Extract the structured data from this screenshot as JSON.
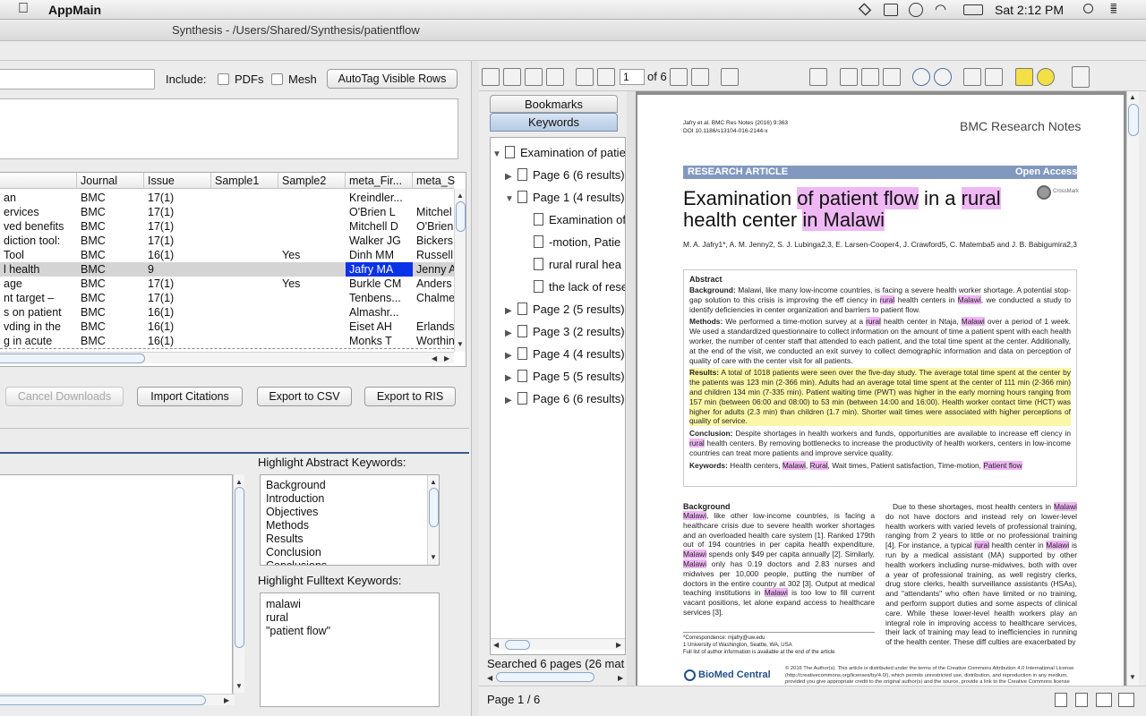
{
  "menubar": {
    "app_name": "AppMain",
    "clock": "Sat 2:12 PM"
  },
  "window": {
    "title": "Synthesis - /Users/Shared/Synthesis/patientflow"
  },
  "left_toolbar": {
    "include_label": "Include:",
    "pdfs_label": "PDFs",
    "mesh_label": "Mesh",
    "autotag_label": "AutoTag Visible Rows"
  },
  "table": {
    "headers": [
      "Journal",
      "Issue",
      "Sample1",
      "Sample2",
      "meta_Fir...",
      "meta_S"
    ],
    "rows": [
      [
        "an",
        "BMC",
        "17(1)",
        "",
        "",
        "Kreindler...",
        ""
      ],
      [
        "ervices",
        "BMC",
        "17(1)",
        "",
        "",
        "O'Brien L",
        "Mitchel"
      ],
      [
        "ved benefits",
        "BMC",
        "17(1)",
        "",
        "",
        "Mitchell D",
        "O'Brien"
      ],
      [
        "diction tool:",
        "BMC",
        "17(1)",
        "",
        "",
        "Walker JG",
        "Bickers"
      ],
      [
        "Tool",
        "BMC",
        "16(1)",
        "",
        "Yes",
        "Dinh MM",
        "Russell"
      ],
      [
        "l health",
        "BMC",
        "9",
        "",
        "",
        "Jafry MA",
        "Jenny A"
      ],
      [
        "age",
        "BMC",
        "17(1)",
        "",
        "Yes",
        "Burkle CM",
        "Anders"
      ],
      [
        "nt target –",
        "BMC",
        "17(1)",
        "",
        "",
        "Tenbens...",
        "Chalme"
      ],
      [
        "s on patient",
        "BMC",
        "16(1)",
        "",
        "",
        "Almashr...",
        ""
      ],
      [
        "vding in the",
        "BMC",
        "16(1)",
        "",
        "",
        "Eiset AH",
        "Erlands"
      ],
      [
        "g in acute",
        "BMC",
        "16(1)",
        "",
        "",
        "Monks T",
        "Worthin"
      ]
    ]
  },
  "actions": {
    "cancel": "Cancel Downloads",
    "import": "Import Citations",
    "export_csv": "Export to CSV",
    "export_ris": "Export to RIS"
  },
  "abstract_keywords": {
    "label": "Highlight Abstract Keywords:",
    "items": [
      "Background",
      "Introduction",
      "Objectives",
      "Methods",
      "Results",
      "Conclusion",
      "Conclusions"
    ]
  },
  "fulltext_keywords": {
    "label": "Highlight Fulltext Keywords:",
    "items": [
      "malawi",
      "rural",
      "\"patient flow\""
    ]
  },
  "pdf_toolbar": {
    "page_input": "1",
    "of_pages": "of 6"
  },
  "side_tabs": {
    "bookmarks": "Bookmarks",
    "keywords": "Keywords"
  },
  "tree": {
    "root": "Examination of patie",
    "nodes": [
      {
        "label": "Page 6 (6 results)",
        "level": 1,
        "expanded": false
      },
      {
        "label": "Page 1 (4 results)",
        "level": 1,
        "expanded": true
      },
      {
        "label": "Examination of",
        "level": 2
      },
      {
        "label": "-motion, Patie",
        "level": 2
      },
      {
        "label": "rural rural hea",
        "level": 2
      },
      {
        "label": "the lack of rese",
        "level": 2
      },
      {
        "label": "Page 2 (5 results)",
        "level": 1,
        "expanded": false
      },
      {
        "label": "Page 3 (2 results)",
        "level": 1,
        "expanded": false
      },
      {
        "label": "Page 4 (4 results)",
        "level": 1,
        "expanded": false
      },
      {
        "label": "Page 5 (5 results)",
        "level": 1,
        "expanded": false
      },
      {
        "label": "Page 6 (6 results)",
        "level": 1,
        "expanded": false
      }
    ],
    "status": "Searched 6 pages (26 mat"
  },
  "status_bar": {
    "page": "Page 1 / 6"
  },
  "pdf": {
    "cite": "Jafry et al. BMC Res Notes (2016) 9:363",
    "doi": "DOI 10.1186/s13104-016-2144-x",
    "journal": "BMC Research Notes",
    "type": "RESEARCH ARTICLE",
    "open_access": "Open Access",
    "title_a": "Examination ",
    "title_b": "of patient flow",
    " title_c": "",
    "title_c2": " in a ",
    "title_d": "rural",
    "title_e": "health center ",
    "title_f": "in Malawi",
    "authors": "M. A. Jafry1*, A. M. Jenny2, S. J. Lubinga2,3, E. Larsen-Cooper4, J. Crawford5, C. Matemba5 and J. B. Babigumira2,3",
    "abstract_h": "Abstract",
    "bg_label": "Background:",
    "bg_text1": "Malawi, like many low-income countries, is facing a severe health worker shortage. A potential stop-gap solution to this crisis is improving the eff ciency in ",
    "bg_rural": "rural",
    "bg_text2": " health centers in ",
    "bg_malawi": "Malawi",
    "bg_text3": ", we conducted a study to identify deficiencies in center organization and barriers to patient flow.",
    "m_label": "Methods:",
    "m_text1": "We performed a time-motion survey at a ",
    "m_rural": "rural",
    "m_text2": " health center in Ntaja, ",
    "m_malawi": "Malawi",
    "m_text3": " over a period of 1 week. We used a standardized questionnaire to collect information on the amount of time a patient spent with each health worker, the number of center staff that attended to each patient, and the total time spent at the center. Additionally, at the end of the visit, we conducted an exit survey to collect demographic information and data on perception of quality of care with the center visit for all patients.",
    "r_label": "Results:",
    "r_text": "A total of 1018 patients were seen over the five-day study. The average total time spent at the center by the patients was 123 min (2-366 min). Adults had an average total time spent at the center of 111 min (2-366 min) and children 134 min (7-335 min). Patient waiting time (PWT) was higher in the early morning hours ranging from 157 min (between 06:00 and 08:00) to 53 min (between 14:00 and 16:00). Health worker contact time (HCT) was higher for adults (2.3 min) than children (1.7 min). Shorter wait times were associated with higher perceptions of quality of service.",
    "c_label": "Conclusion:",
    "c_text1": "Despite shortages in health workers and funds, opportunities are available to increase eff ciency in ",
    "c_rural": "rural",
    "c_text2": " health centers. By removing bottlenecks to increase the productivity of health workers, centers in low-income countries can treat more patients and improve service quality.",
    "k_label": "Keywords:",
    "k_text1": "Health centers, ",
    "k_malawi": "Malawi",
    "k_sep1": ", ",
    "k_rural": "Rural",
    "k_text2": ", Wait times, Patient satisfaction, Time-motion, ",
    "k_pf": "Patient flow",
    "body_h": "Background",
    "body_l1": "Malawi",
    "body_l2": ", like other low-income countries, is facing a healthcare crisis due to severe health worker shortages and an overloaded health care system [1]. Ranked 179th out of 194 countries in per capita health expenditure, ",
    "body_l3": "Malawi",
    "body_l4": " spends only $49 per capita annually [2]. Similarly, ",
    "body_l5": "Malawi",
    "body_l6": " only has 0.19 doctors and 2.83 nurses and midwives per 10,000 people, putting the number of doctors in the entire country at 302 [3]. Output at medical teaching institutions in ",
    "body_l7": "Malawi",
    "body_l8": " is too low to fill current vacant positions, let alone expand access to healthcare services [3].",
    "body_r1": "Due to these shortages, most health centers in ",
    "body_r2": "Malawi",
    "body_r3": " do not have doctors and instead rely on lower-level health workers with varied levels of professional training, ranging from 2 years to little or no professional training [4]. For instance, a typical ",
    "body_r4": "rural",
    "body_r5": " health center in ",
    "body_r6": "Malawi",
    "body_r7": " is run by a medical assistant (MA) supported by other health workers including nurse-midwives, both with over a year of professional training, as well registry clerks, drug store clerks, health surveillance assistants (HSAs), and \"attendants\" who often have limited or no training, and perform support duties and some aspects of clinical care. While these lower-level health workers play an integral role in improving access to healthcare services, their lack of training may lead to inefficiencies in running of the health center. These diff culties are exacerbated by",
    "corr1": "*Correspondence: mjafry@uw.edu",
    "corr2": "1 University of Washington, Seattle, WA, USA",
    "corr3": "Full list of author information is available at the end of the article",
    "biomed": "BioMed Central",
    "license": "© 2016 The Author(s). This article is distributed under the terms of the Creative Commons Attribution 4.0 International License (http://creativecommons.org/licenses/by/4.0/), which permits unrestricted use, distribution, and reproduction in any medium, provided you give appropriate credit to the original author(s) and the source, provide a link to the Creative Commons license"
  }
}
